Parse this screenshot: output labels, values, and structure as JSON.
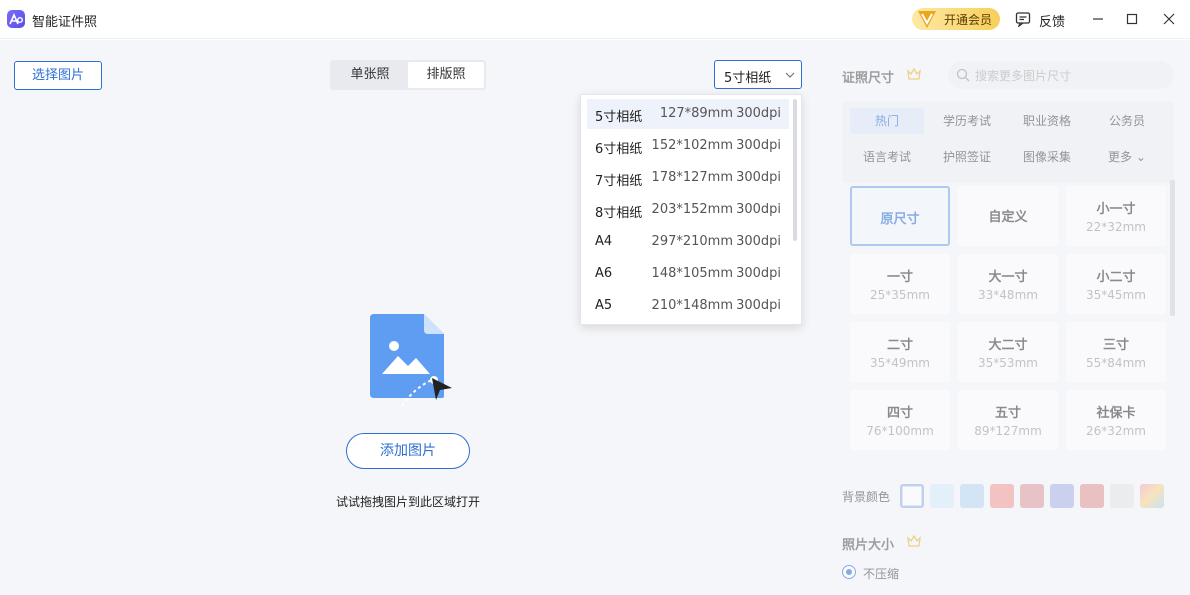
{
  "app": {
    "title": "智能证件照"
  },
  "titlebar": {
    "vip_label": "开通会员",
    "feedback_label": "反馈"
  },
  "toolbar": {
    "select_image_label": "选择图片",
    "modes": [
      "单张照",
      "排版照"
    ],
    "active_mode": "排版照",
    "paper_selected": "5寸相纸"
  },
  "paper_options": [
    {
      "name": "5寸相纸",
      "size": "127*89mm",
      "dpi": "300dpi"
    },
    {
      "name": "6寸相纸",
      "size": "152*102mm",
      "dpi": "300dpi"
    },
    {
      "name": "7寸相纸",
      "size": "178*127mm",
      "dpi": "300dpi"
    },
    {
      "name": "8寸相纸",
      "size": "203*152mm",
      "dpi": "300dpi"
    },
    {
      "name": "A4",
      "size": "297*210mm",
      "dpi": "300dpi"
    },
    {
      "name": "A6",
      "size": "148*105mm",
      "dpi": "300dpi"
    },
    {
      "name": "A5",
      "size": "210*148mm",
      "dpi": "300dpi"
    }
  ],
  "drop_area": {
    "add_label": "添加图片",
    "hint": "试试拖拽图片到此区域打开"
  },
  "panel": {
    "size_title": "证照尺寸",
    "search_placeholder": "搜索更多图片尺寸",
    "categories": [
      "热门",
      "学历考试",
      "职业资格",
      "公务员",
      "语言考试",
      "护照签证",
      "图像采集",
      "更多"
    ],
    "active_category": "热门",
    "sizes": [
      {
        "name": "原尺寸",
        "dim": ""
      },
      {
        "name": "自定义",
        "dim": ""
      },
      {
        "name": "小一寸",
        "dim": "22*32mm"
      },
      {
        "name": "一寸",
        "dim": "25*35mm"
      },
      {
        "name": "大一寸",
        "dim": "33*48mm"
      },
      {
        "name": "小二寸",
        "dim": "35*45mm"
      },
      {
        "name": "二寸",
        "dim": "35*49mm"
      },
      {
        "name": "大二寸",
        "dim": "35*53mm"
      },
      {
        "name": "三寸",
        "dim": "55*84mm"
      },
      {
        "name": "四寸",
        "dim": "76*100mm"
      },
      {
        "name": "五寸",
        "dim": "89*127mm"
      },
      {
        "name": "社保卡",
        "dim": "26*32mm"
      }
    ],
    "bg_label": "背景颜色",
    "bg_colors": [
      "#ffffff",
      "#d6ecfb",
      "#b9d6f3",
      "#f29a9a",
      "#dd9a9f",
      "#aab2e6",
      "#e09698",
      "#e4e4e4",
      "gradient"
    ],
    "photo_size_title": "照片大小",
    "compress_label": "不压缩"
  }
}
